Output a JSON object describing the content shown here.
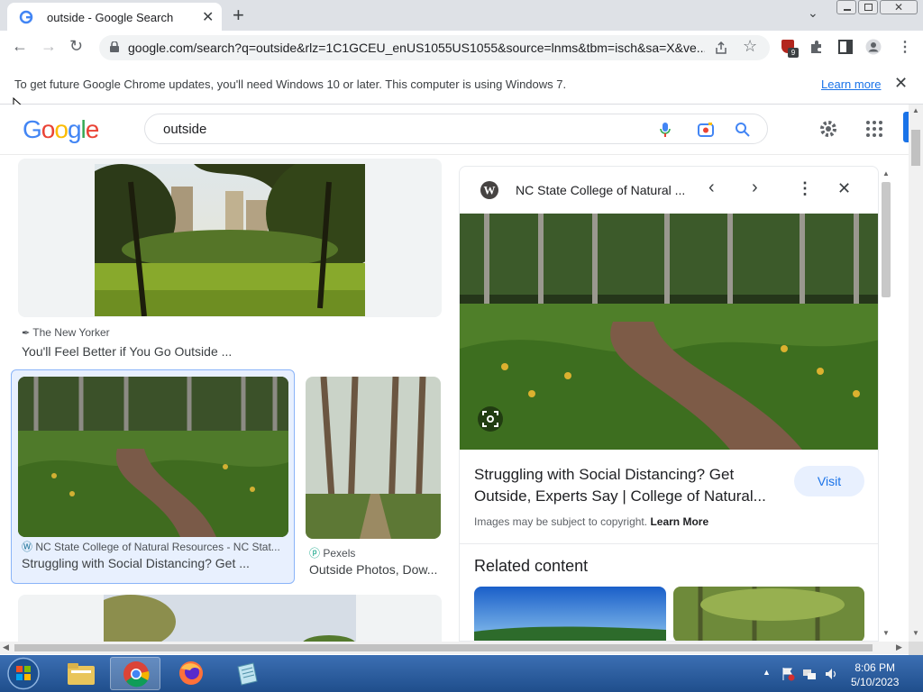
{
  "browser": {
    "tab_title": "outside - Google Search",
    "url": "google.com/search?q=outside&rlz=1C1GCEU_enUS1055US1055&source=lnms&tbm=isch&sa=X&ve...",
    "extension_badge": "9"
  },
  "infobar": {
    "message": "To get future Google Chrome updates, you'll need Windows 10 or later. This computer is using Windows 7.",
    "link": "Learn more"
  },
  "search": {
    "logo": "Google",
    "query": "outside"
  },
  "results": [
    {
      "source": "The New Yorker",
      "caption": "You'll Feel Better if You Go Outside ..."
    },
    {
      "source": "NC State College of Natural Resources - NC Stat...",
      "caption": "Struggling with Social Distancing? Get ..."
    },
    {
      "source": "Pexels",
      "caption": "Outside Photos, Dow..."
    }
  ],
  "panel": {
    "site": "NC State College of Natural ...",
    "title": "Struggling with Social Distancing? Get Outside, Experts Say | College of Natural...",
    "visit": "Visit",
    "copyright": "Images may be subject to copyright.",
    "copyright_link": "Learn More",
    "related": "Related content"
  },
  "taskbar": {
    "time": "8:06 PM",
    "date": "5/10/2023"
  },
  "colors": {
    "accent": "#1a73e8",
    "tabbar": "#dee1e6"
  }
}
